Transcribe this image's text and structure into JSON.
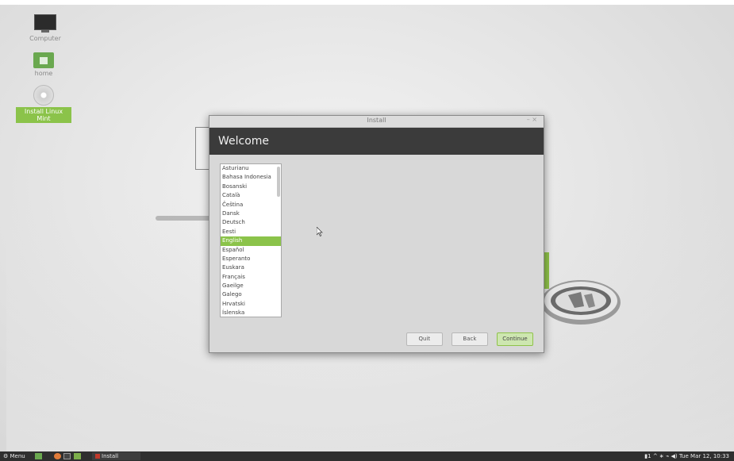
{
  "desktop": {
    "icons": [
      {
        "label": "Computer",
        "icon": "computer-icon"
      },
      {
        "label": "home",
        "icon": "home-folder-icon"
      },
      {
        "label": "Install Linux Mint",
        "icon": "install-disc-icon"
      }
    ]
  },
  "window": {
    "title": "Install",
    "controls": "– ×",
    "heading": "Welcome",
    "languages": [
      "Asturianu",
      "Bahasa Indonesia",
      "Bosanski",
      "Català",
      "Čeština",
      "Dansk",
      "Deutsch",
      "Eesti",
      "English",
      "Español",
      "Esperanto",
      "Euskara",
      "Français",
      "Gaeilge",
      "Galego",
      "Hrvatski",
      "Íslenska"
    ],
    "selected_language": "English",
    "buttons": {
      "quit": "Quit",
      "back": "Back",
      "continue": "Continue"
    }
  },
  "taskbar": {
    "menu_label": "Menu",
    "task_label": "Install",
    "workspace": "1",
    "clock": "Tue Mar 12, 10:33"
  },
  "colors": {
    "accent": "#8bc34a",
    "banner": "#3b3b3b",
    "taskbar": "#2f2f2f"
  }
}
